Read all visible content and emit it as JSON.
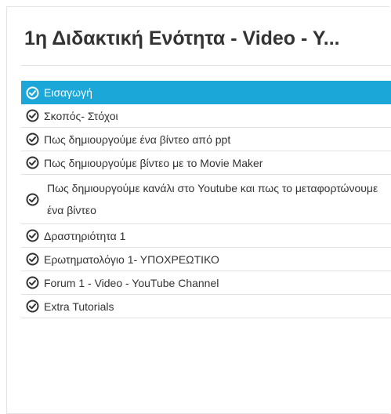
{
  "section": {
    "title": "1η Διδακτική Ενότητα - Video - Y..."
  },
  "lessons": [
    {
      "label": "Εισαγωγή",
      "active": true,
      "icon": "check-circle-icon"
    },
    {
      "label": "Σκοπός- Στόχοι",
      "active": false,
      "icon": "check-circle-icon"
    },
    {
      "label": "Πως δημιουργούμε ένα βίντεο από ppt",
      "active": false,
      "icon": "check-circle-icon"
    },
    {
      "label": "Πως δημιουργούμε βίντεο με το Movie Maker",
      "active": false,
      "icon": "check-circle-icon"
    },
    {
      "label": "Πως δημιουργούμε κανάλι στο Youtube και πως το μεταφορτώνουμε ένα βίντεο",
      "active": false,
      "icon": "check-circle-icon"
    },
    {
      "label": "Δραστηριότητα 1",
      "active": false,
      "icon": "check-circle-icon"
    },
    {
      "label": "Ερωτηματολόγιο 1- ΥΠΟΧΡΕΩΤΙΚΟ",
      "active": false,
      "icon": "check-circle-icon"
    },
    {
      "label": "Forum 1 - Video - YouTube Channel",
      "active": false,
      "icon": "check-circle-icon"
    },
    {
      "label": "Extra Tutorials",
      "active": false,
      "icon": "check-circle-icon"
    }
  ],
  "colors": {
    "active_background": "#1ba7d8",
    "active_text": "#ffffff",
    "text": "#333333"
  }
}
